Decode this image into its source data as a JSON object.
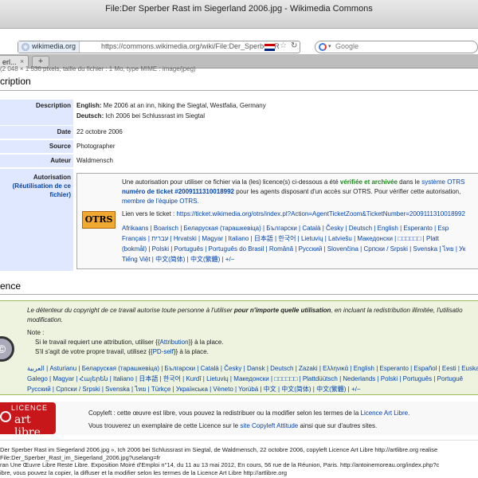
{
  "window": {
    "title": "File:Der Sperber Rast im Siegerland 2006.jpg - Wikimedia Commons"
  },
  "toolbar": {
    "site_badge": "wikimedia.org",
    "url": "https://commons.wikimedia.org/wiki/File:Der_Sperber_R",
    "search_placeholder": "Google",
    "tab_label": "erl...",
    "tab_close": "×",
    "new_tab": "+",
    "clipped_text": "(2 048 × 1 536 pixels, taille du fichier : 1 Mo, type MIME : image/jpeg)"
  },
  "description_section": {
    "heading": "cription",
    "rows": [
      {
        "label": "Description",
        "value_en_lang": "English:",
        "value_en": " Me 2006 at an inn, hiking the Siegtal, Westfalia, Germany",
        "value_de_lang": "Deutsch:",
        "value_de": " Ich 2006 bei Schlussrast im Siegtal"
      },
      {
        "label": "Date",
        "value": "22 octobre 2006"
      },
      {
        "label": "Source",
        "value": "Photographer"
      },
      {
        "label": "Auteur",
        "value": "Waldmensch"
      }
    ],
    "autorisation": {
      "label_1": "Autorisation",
      "label_2": "(Réutilisation de ce",
      "label_3": "fichier)",
      "otrs_logo": "OTRS",
      "line1_a": "Une autorisation pour utiliser ce fichier via la (les) licence(s) ci-dessous a été ",
      "line1_b": "vérifiée et archivée",
      "line1_c": " dans le ",
      "line1_d": "système OTRS",
      "line2_a": "numéro de ticket #2009111310018992",
      "line2_b": " pour les agents disposant d'un accès sur OTRS. Pour vérifier cette autorisation,",
      "line3": "membre de l'équipe OTRS.",
      "ticket_label": "Lien vers le ticket : ",
      "ticket_url": "https://ticket.wikimedia.org/otrs/index.pl?Action=AgentTicketZoom&TicketNumber=2009111310018992",
      "langs": [
        "Afrikaans | Boarisch | Беларуская (тарашкевіца) | Български | Català | Česky | Deutsch | English | Esperanto | Esp",
        "Français | עברית | Hrvatski | Magyar | Italiano | 日本語 | 한국어 | Lietuvių | Latviešu | Македонски | □□□□□□ | Platt",
        "(bokmål) | Polski | Português | Português do Brasil | Română | Русский | Slovenčina | Српски / Srpski | Svenska | ไทย | Ук",
        "Tiếng Việt | 中文(简体) | 中文(繁體) | +/−"
      ]
    }
  },
  "licence_section": {
    "heading": "ence",
    "cc_icon": "©",
    "line1_a": "Le détenteur du copyright de ce travail autorise toute personne à l'utiliser ",
    "line1_b": "pour n'importe quelle utilisation",
    "line1_c": ", en incluant la redistribution illimitée, l'utilisatio",
    "line2": "modification.",
    "note": "Note :",
    "note1_a": "Si le travail requiert une attribution, utiliser {{",
    "note1_link": "Attribution",
    "note1_b": "}} à la place.",
    "note2_a": "S'il s'agit de votre propre travail, utilisez {{",
    "note2_link": "PD-self",
    "note2_b": "}} à la place.",
    "langs": [
      "العربية | Asturianu | Беларуская (тарашкевіца) | Български | Català | Česky | Dansk | Deutsch | Zazaki | Ελληνικά | English | Esperanto | Español | Eesti | Euskara",
      "Galego | Magyar | Հայերեն | Italiano | 日本語 | 한국어 | Kurdî | Lietuvių | Македонски | □□□□□□ | Plattdüütsch | Nederlands | Polski | Português | Portuguê",
      "Русский | Српски / Srpski | Svenska | ไทย | Türkçe | Українська | Vèneto | Yorùbá | 中文 | 中文(简体) | 中文(繁體) | +/−"
    ]
  },
  "art_libre": {
    "logo_line1": "LICENCE",
    "logo_line2": "art libre",
    "line1_a": "Copyleft : cette œuvre est libre, vous pouvez la redistribuer ou la modifier selon les termes de la ",
    "line1_link": "Licence Art Libre",
    "line1_b": ".",
    "line2_a": "Vous trouverez un exemplaire de cette Licence sur le ",
    "line2_link": "site Copyleft Attitude",
    "line2_b": " ainsi que sur d'autres sites."
  },
  "footer": {
    "lines": [
      "Der Sperber Rast im Siegerland 2006.jpg », Ich 2006 bei Schlussrast im Siegtal, de Waldmensch, 22 octobre 2006, copyleft Licence Art Libre http://artlibre.org realise",
      "File:Der_Sperber_Rast_im_Siegerland_2006.jpg?uselang=fr",
      "ran Une Œuvre Libre Reste Libre. Exposition Moiré d'Emploi n°14, du 11 au 13 mai 2012, En cours, 56 rue de la Réunion, Paris. http://antoinemoreau.org/index.php?c",
      "ibre, vous pouvez la copier, la diffuser et la modifier selon les termes de la Licence Art Libre http://artlibre.org"
    ]
  },
  "colors": {
    "label_bg": "#e0e8ff",
    "link": "#0645ad",
    "licence_bg": "#eef3df",
    "otrs_orange": "#f0a830",
    "art_libre_red": "#c7171b"
  }
}
